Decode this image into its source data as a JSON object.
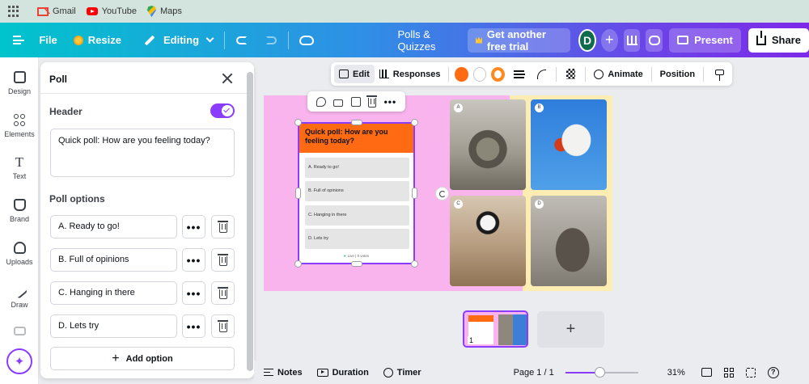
{
  "bookmarks": {
    "items": [
      {
        "label": "Gmail",
        "icon": "gmail-icon"
      },
      {
        "label": "YouTube",
        "icon": "youtube-icon"
      },
      {
        "label": "Maps",
        "icon": "maps-icon"
      }
    ]
  },
  "topbar": {
    "file_label": "File",
    "resize_label": "Resize",
    "editing_label": "Editing",
    "title": "Polls & Quizzes",
    "trial_label": "Get another free trial",
    "avatar_initial": "D",
    "plus_label": "+",
    "present_label": "Present",
    "share_label": "Share"
  },
  "rail": {
    "items": [
      {
        "label": "Design",
        "icon": "design-icon"
      },
      {
        "label": "Elements",
        "icon": "elements-icon"
      },
      {
        "label": "Text",
        "icon": "text-icon"
      },
      {
        "label": "Brand",
        "icon": "brand-icon"
      },
      {
        "label": "Uploads",
        "icon": "uploads-icon"
      },
      {
        "label": "Draw",
        "icon": "draw-icon"
      }
    ]
  },
  "panel": {
    "title": "Poll",
    "header_label": "Header",
    "header_enabled": true,
    "question": "Quick poll: How are you feeling today?",
    "options_label": "Poll options",
    "options": [
      "A. Ready to go!",
      "B. Full of opinions",
      "C. Hanging in there",
      "D. Lets try"
    ],
    "more_label": "•••",
    "add_option_label": "Add option",
    "add_plus": "+"
  },
  "toolbar": {
    "edit_label": "Edit",
    "responses_label": "Responses",
    "animate_label": "Animate",
    "position_label": "Position",
    "colors": {
      "fill": "#ff6a13",
      "secondary": "#ffffff",
      "ring": "#ff8a1f"
    }
  },
  "float_bar": {
    "more_label": "•••"
  },
  "canvas": {
    "poll_question": "Quick poll: How are you feeling today?",
    "poll_options": [
      "A. Ready to go!",
      "B. Full of opinions",
      "C. Hanging in there",
      "D. Lets try"
    ],
    "poll_footer": "Live | 0 votes",
    "photo_labels": [
      "A",
      "B",
      "C",
      "D"
    ],
    "background_color": "#f9b4ee",
    "accent_color": "#ff6a13",
    "selection_color": "#8b3dff"
  },
  "pages": {
    "thumb_number": "1",
    "add_page_label": "+"
  },
  "bottombar": {
    "notes_label": "Notes",
    "duration_label": "Duration",
    "timer_label": "Timer",
    "page_indicator": "Page 1 / 1",
    "zoom_value": "31%",
    "zoom_fraction": 0.47,
    "help_label": "?"
  }
}
